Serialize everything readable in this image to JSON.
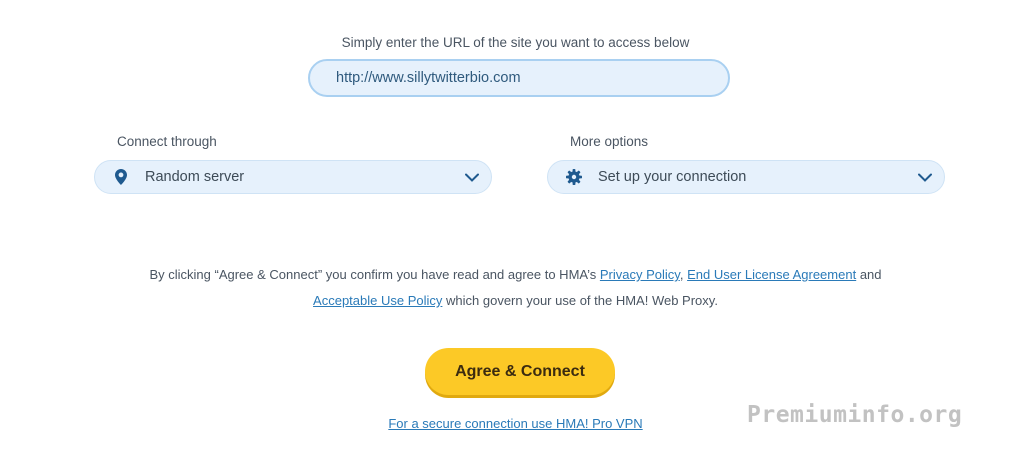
{
  "url_section": {
    "label": "Simply enter the URL of the site you want to access below",
    "value": "http://www.sillytwitterbio.com"
  },
  "connect_through": {
    "label": "Connect through",
    "selected": "Random server",
    "icon": "location-pin-icon"
  },
  "more_options": {
    "label": "More options",
    "selected": "Set up your connection",
    "icon": "gear-icon"
  },
  "consent": {
    "prefix": "By clicking “Agree & Connect” you confirm you have read and agree to HMA’s",
    "privacy_link": "Privacy Policy",
    "sep1": ",",
    "eula_link": "End User License Agreement",
    "and_text": "and",
    "aup_link": "Acceptable Use Policy",
    "suffix": "which govern your use of the HMA! Web Proxy."
  },
  "cta": {
    "label": "Agree & Connect",
    "color": "#fcc926"
  },
  "secure_link": "For a secure connection use HMA! Pro VPN",
  "watermark": "Premiuminfo.org",
  "colors": {
    "accent": "#2a7ab8",
    "field_bg": "#e6f1fc",
    "cta": "#fcc926",
    "icon": "#1f5a8f"
  }
}
